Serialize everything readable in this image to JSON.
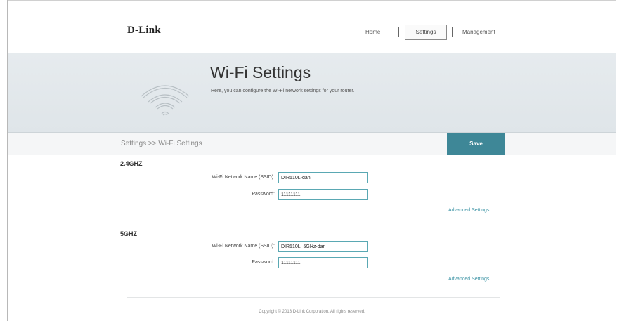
{
  "header": {
    "logo": "D-Link",
    "nav": {
      "home": "Home",
      "settings": "Settings",
      "management": "Management",
      "active": "Settings"
    }
  },
  "banner": {
    "title": "Wi-Fi Settings",
    "description": "Here, you can configure the Wi-Fi network settings for your router.",
    "icon": "wifi-icon"
  },
  "breadcrumb": "Settings >> Wi-Fi Settings",
  "save_label": "Save",
  "sections": [
    {
      "title": "2.4GHZ",
      "ssid_label": "Wi-Fi Network Name (SSID):",
      "ssid_value": "DIR510L-dan",
      "password_label": "Password:",
      "password_value": "11111111",
      "advanced_link": "Advanced Settings..."
    },
    {
      "title": "5GHZ",
      "ssid_label": "Wi-Fi Network Name (SSID):",
      "ssid_value": "DIR510L_5GHz-dan",
      "password_label": "Password:",
      "password_value": "11111111",
      "advanced_link": "Advanced Settings..."
    }
  ],
  "footer": {
    "copyright": "Copyright © 2013 D-Link Corporation. All rights reserved."
  },
  "colors": {
    "accent": "#3e8797",
    "link": "#3f95a6",
    "input_border": "#5aa8b3",
    "banner_bg": "#e3e8eb"
  }
}
